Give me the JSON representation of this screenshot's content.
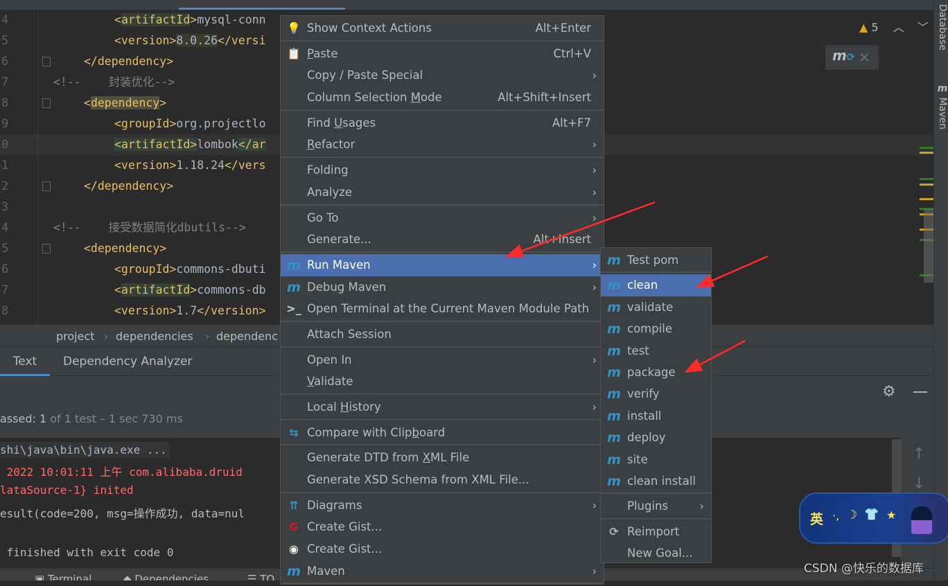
{
  "editor": {
    "lines": [
      {
        "n": "4",
        "indent": 165,
        "segs": [
          {
            "t": "<",
            "c": "tag"
          },
          {
            "t": "artifactId",
            "c": "tag hlg"
          },
          {
            "t": ">",
            "c": "tag"
          },
          {
            "t": "mysql-conn",
            "c": "txt"
          }
        ]
      },
      {
        "n": "5",
        "indent": 165,
        "segs": [
          {
            "t": "<version>",
            "c": "tag"
          },
          {
            "t": "8.0.26",
            "c": "txt hly"
          },
          {
            "t": "</versi",
            "c": "tag"
          }
        ]
      },
      {
        "n": "6",
        "indent": 121,
        "segs": [
          {
            "t": "</dependency>",
            "c": "tag"
          }
        ]
      },
      {
        "n": "7",
        "indent": 77,
        "segs": [
          {
            "t": "<!--    封装优化-->",
            "c": "cmt"
          }
        ]
      },
      {
        "n": "8",
        "indent": 121,
        "segs": [
          {
            "t": "<",
            "c": "tag"
          },
          {
            "t": "dependency",
            "c": "tag hld"
          },
          {
            "t": ">",
            "c": "tag"
          }
        ]
      },
      {
        "n": "9",
        "indent": 165,
        "segs": [
          {
            "t": "<groupId>",
            "c": "tag"
          },
          {
            "t": "org.projectlo",
            "c": "txt"
          }
        ]
      },
      {
        "n": "0",
        "indent": 165,
        "segs": [
          {
            "t": "<",
            "c": "tag hlb"
          },
          {
            "t": "artifactId",
            "c": "tag hlg"
          },
          {
            "t": ">",
            "c": "tag hlb"
          },
          {
            "t": "lombok",
            "c": "txt"
          },
          {
            "t": "</",
            "c": "tag hlb"
          },
          {
            "t": "ar",
            "c": "tag hlg"
          }
        ]
      },
      {
        "n": "1",
        "indent": 165,
        "segs": [
          {
            "t": "<version>",
            "c": "tag"
          },
          {
            "t": "1.18.24",
            "c": "txt"
          },
          {
            "t": "</vers",
            "c": "tag"
          }
        ]
      },
      {
        "n": "2",
        "indent": 121,
        "segs": [
          {
            "t": "</dependency>",
            "c": "tag"
          }
        ]
      },
      {
        "n": "3",
        "indent": 77,
        "segs": []
      },
      {
        "n": "4",
        "indent": 77,
        "segs": [
          {
            "t": "<!--    接受数据简化dbutils-->",
            "c": "cmt"
          }
        ]
      },
      {
        "n": "5",
        "indent": 121,
        "segs": [
          {
            "t": "<dependency>",
            "c": "tag"
          }
        ]
      },
      {
        "n": "6",
        "indent": 165,
        "segs": [
          {
            "t": "<groupId>",
            "c": "tag"
          },
          {
            "t": "commons-dbuti",
            "c": "txt"
          }
        ]
      },
      {
        "n": "7",
        "indent": 165,
        "segs": [
          {
            "t": "<",
            "c": "tag"
          },
          {
            "t": "artifactId",
            "c": "tag hlg"
          },
          {
            "t": ">",
            "c": "tag"
          },
          {
            "t": "commons-db",
            "c": "txt"
          }
        ]
      },
      {
        "n": "8",
        "indent": 165,
        "segs": [
          {
            "t": "<version>",
            "c": "tag"
          },
          {
            "t": "1.7",
            "c": "txt"
          },
          {
            "t": "</version>",
            "c": "tag"
          }
        ]
      }
    ],
    "warning_count": "5",
    "stripe_colors": {
      "green": "#2f7a2f",
      "yellow": "#c9a227"
    }
  },
  "right_strip": {
    "database": "Database",
    "maven": "Maven"
  },
  "breadcrumb": [
    "project",
    "dependencies",
    "dependenc"
  ],
  "bottom_tabs": [
    {
      "label": "Text",
      "active": true
    },
    {
      "label": "Dependency Analyzer",
      "active": false
    }
  ],
  "run": {
    "passed_prefix": "assed: ",
    "passed_count": "1",
    "passed_rest": " of 1 test – 1 sec 730 ms",
    "console": [
      {
        "t": "shi\\java\\bin\\java.exe ...",
        "c": "#a9b7c6"
      },
      {
        "t": " 2022 10:01:11 上午 com.alibaba.druid",
        "c": "#ff6b68"
      },
      {
        "t": "lataSource-1} inited",
        "c": "#ff6b68"
      },
      {
        "t": "esult(code=200, msg=操作成功, data=nul",
        "c": "#bbbbbb"
      },
      {
        "t": " finished with exit code 0",
        "c": "#bbbbbb"
      }
    ]
  },
  "status_bar": [
    "Terminal",
    "Dependencies",
    "TO"
  ],
  "context_menu": {
    "accent": "#4b6eaf",
    "items": [
      {
        "label": "Show Context Actions",
        "shortcut": "Alt+Enter",
        "icon": "lightbulb-icon"
      },
      {
        "sep": true
      },
      {
        "label": "Paste",
        "u": "P",
        "shortcut": "Ctrl+V",
        "icon": "clipboard-icon"
      },
      {
        "label": "Copy / Paste Special",
        "submenu": true
      },
      {
        "label": "Column Selection Mode",
        "u": "M",
        "shortcut": "Alt+Shift+Insert"
      },
      {
        "sep": true
      },
      {
        "label": "Find Usages",
        "u": "U",
        "shortcut": "Alt+F7"
      },
      {
        "label": "Refactor",
        "u": "R",
        "submenu": true
      },
      {
        "sep": true
      },
      {
        "label": "Folding",
        "submenu": true
      },
      {
        "label": "Analyze",
        "submenu": true
      },
      {
        "sep": true
      },
      {
        "label": "Go To",
        "submenu": true
      },
      {
        "label": "Generate...",
        "shortcut": "Alt+Insert"
      },
      {
        "sep": true
      },
      {
        "label": "Run Maven",
        "submenu": true,
        "selected": true,
        "icon": "maven-run-icon"
      },
      {
        "label": "Debug Maven",
        "submenu": true,
        "icon": "maven-debug-icon"
      },
      {
        "label": "Open Terminal at the Current Maven Module Path",
        "icon": "terminal-maven-icon"
      },
      {
        "sep": true
      },
      {
        "label": "Attach Session"
      },
      {
        "sep": true
      },
      {
        "label": "Open In",
        "submenu": true
      },
      {
        "label": "Validate",
        "u": "V"
      },
      {
        "sep": true
      },
      {
        "label": "Local History",
        "u": "H",
        "submenu": true
      },
      {
        "sep": true
      },
      {
        "label": "Compare with Clipboard",
        "u": "b",
        "icon": "compare-clipboard-icon"
      },
      {
        "sep": true
      },
      {
        "label": "Generate DTD from XML File",
        "u": "X"
      },
      {
        "label": "Generate XSD Schema from XML File..."
      },
      {
        "sep": true
      },
      {
        "label": "Diagrams",
        "submenu": true,
        "icon": "diagram-icon"
      },
      {
        "label": "Create Gist...",
        "icon": "gitee-icon"
      },
      {
        "label": "Create Gist...",
        "icon": "github-icon"
      },
      {
        "label": "Maven",
        "submenu": true,
        "icon": "maven-icon"
      },
      {
        "sep": true
      }
    ]
  },
  "run_maven_submenu": {
    "items": [
      {
        "label": "Test pom",
        "icon": "maven-icon"
      },
      {
        "sep": true
      },
      {
        "label": "clean",
        "icon": "maven-run-icon",
        "selected": true
      },
      {
        "label": "validate",
        "icon": "maven-run-icon"
      },
      {
        "label": "compile",
        "icon": "maven-run-icon"
      },
      {
        "label": "test",
        "icon": "maven-run-icon"
      },
      {
        "label": "package",
        "icon": "maven-run-icon"
      },
      {
        "label": "verify",
        "icon": "maven-run-icon"
      },
      {
        "label": "install",
        "icon": "maven-run-icon"
      },
      {
        "label": "deploy",
        "icon": "maven-run-icon"
      },
      {
        "label": "site",
        "icon": "maven-run-icon"
      },
      {
        "label": "clean install",
        "icon": "maven-run-icon"
      },
      {
        "sep": true
      },
      {
        "label": "Plugins",
        "submenu": true
      },
      {
        "sep": true
      },
      {
        "label": "Reimport",
        "icon": "reimport-icon"
      },
      {
        "label": "New Goal..."
      }
    ]
  },
  "ime": {
    "label": "英"
  },
  "watermark": "CSDN @快乐的数据库",
  "annotation_color": "#ff2a2a"
}
